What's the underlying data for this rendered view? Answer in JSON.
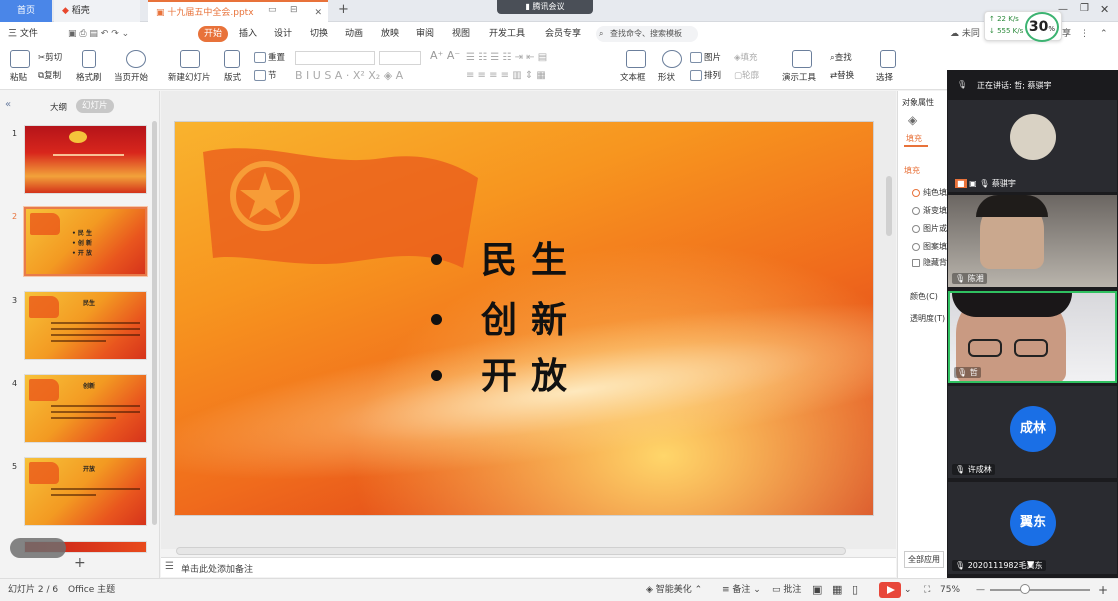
{
  "tabs": {
    "home": "首页",
    "shell": "稻壳",
    "doc": "十九届五中全会.pptx",
    "new_tab": "+"
  },
  "meeting_app": {
    "badge": "腾讯会议",
    "speaking": "正在讲话: 哲; 蔡骐宇",
    "participants": [
      {
        "name": "蔡骐宇"
      },
      {
        "name": "陈湘"
      },
      {
        "name": "哲"
      },
      {
        "name": "许成林",
        "avatar": "成林"
      },
      {
        "name": "2020111982毛翼东",
        "avatar": "翼东"
      }
    ]
  },
  "network": {
    "up": "↑ 22 K/s",
    "down": "↓ 555 K/s",
    "percent": "30",
    "percent_unit": "%"
  },
  "menu": {
    "file": "三 文件",
    "items": [
      "开始",
      "插入",
      "设计",
      "切换",
      "动画",
      "放映",
      "审阅",
      "视图",
      "开发工具",
      "会员专享"
    ],
    "active": "开始",
    "search_placeholder": "查找命令、搜索模板",
    "unsync": "未同",
    "share": "享"
  },
  "ribbon": {
    "paste": "粘贴",
    "cut": "剪切",
    "copy": "复制",
    "format_painter": "格式刷",
    "from_current": "当页开始",
    "new_slide": "新建幻灯片",
    "layout": "版式",
    "reset": "重置",
    "section": "节",
    "textbox": "文本框",
    "shape": "形状",
    "picture": "图片",
    "arrange": "排列",
    "fill": "填充",
    "outline": "轮廓",
    "presenter_tools": "演示工具",
    "find": "查找",
    "replace": "替换",
    "select": "选择"
  },
  "left_panel": {
    "outline_tab": "大纲",
    "slides_tab": "幻灯片",
    "thumbnails": [
      "1",
      "2",
      "3",
      "4",
      "5"
    ],
    "thumb_titles": [
      "",
      "",
      "民生",
      "创新",
      "开放"
    ]
  },
  "slide": {
    "bullets": [
      "民生",
      "创新",
      "开放"
    ]
  },
  "notes_placeholder": "单击此处添加备注",
  "right_panel": {
    "title": "对象属性",
    "fill_tab": "填充",
    "fill_section": "填充",
    "options": [
      "纯色填",
      "渐变填",
      "图片或",
      "图案填",
      "隐藏背"
    ],
    "color": "颜色(C)",
    "transparency": "透明度(T)",
    "apply_all": "全部应用"
  },
  "status": {
    "slide_info": "幻灯片 2 / 6",
    "theme": "Office 主题",
    "smart_beautify": "智能美化",
    "notes": "备注",
    "comments": "批注",
    "zoom": "75%"
  }
}
